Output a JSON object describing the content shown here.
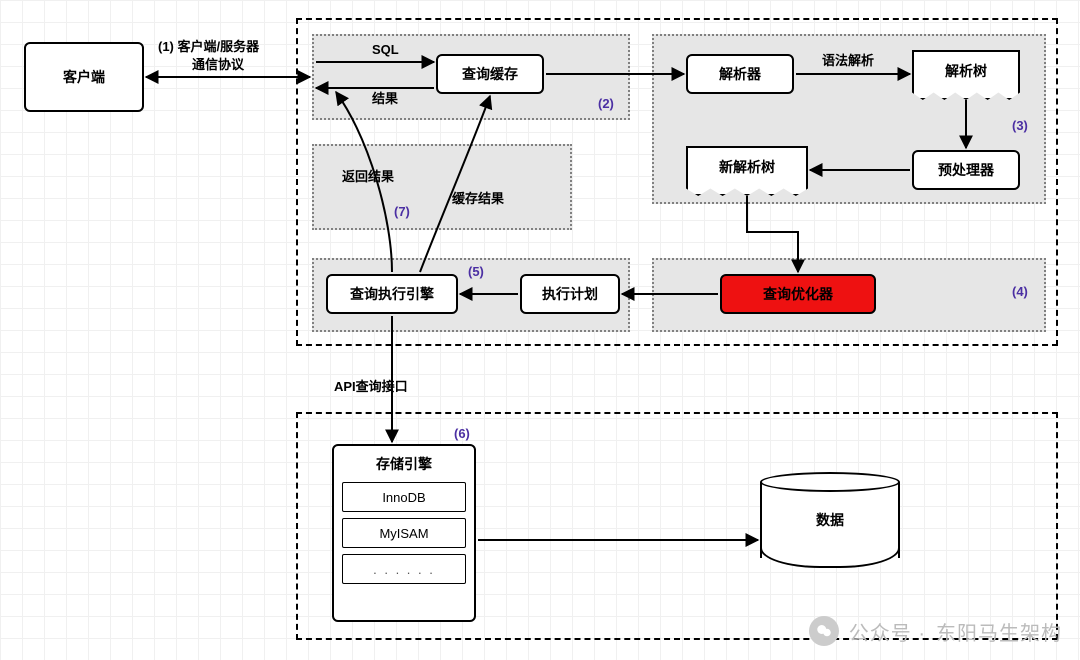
{
  "nodes": {
    "client": "客户端",
    "query_cache": "查询缓存",
    "parser": "解析器",
    "parse_tree": "解析树",
    "preprocessor": "预处理器",
    "new_parse_tree": "新解析树",
    "optimizer": "查询优化器",
    "exec_plan": "执行计划",
    "exec_engine": "查询执行引擎",
    "storage_engine": "存储引擎",
    "engine_innodb": "InnoDB",
    "engine_myisam": "MyISAM",
    "engine_more": ". . . . . .",
    "data_cyl": "数据"
  },
  "edges": {
    "client_server_protocol_line1": "(1) 客户端/服务器",
    "client_server_protocol_line2": "通信协议",
    "sql": "SQL",
    "result": "结果",
    "syntax_parse": "语法解析",
    "return_result": "返回结果",
    "cache_result": "缓存结果",
    "api_query": "API查询接口"
  },
  "sections": {
    "s2": "(2)",
    "s3": "(3)",
    "s4": "(4)",
    "s5": "(5)",
    "s6": "(6)",
    "s7": "(7)"
  },
  "watermark": {
    "prefix": "公众号 · ",
    "name": "东阳马生架构"
  }
}
